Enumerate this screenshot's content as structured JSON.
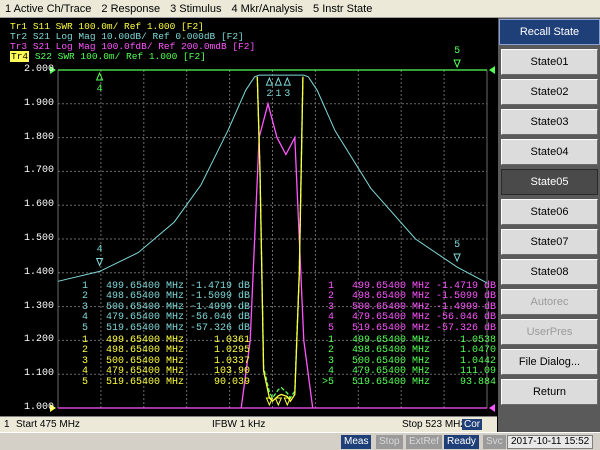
{
  "menu": [
    "1 Active Ch/Trace",
    "2 Response",
    "3 Stimulus",
    "4 Mkr/Analysis",
    "5 Instr State"
  ],
  "traces": [
    {
      "label": "Tr1",
      "text": "S11  SWR 100.0m/ Ref 1.000 [F2]",
      "color": "#ffff40"
    },
    {
      "label": "Tr2",
      "text": "S21  Log Mag 10.00dB/ Ref 0.000dB [F2]",
      "color": "#7fd8d8"
    },
    {
      "label": "Tr3",
      "text": "S21  Log Mag 100.0fdB/ Ref 200.0mdB [F2]",
      "color": "#ff55ff"
    },
    {
      "label": "Tr4",
      "text": "S22  SWR 100.0m/ Ref 1.000 [F2]",
      "color": "#55ff55"
    }
  ],
  "y_ticks": [
    "2.000",
    "1.900",
    "1.800",
    "1.700",
    "1.600",
    "1.500",
    "1.400",
    "1.300",
    "1.200",
    "1.100",
    "1.000"
  ],
  "chart_data": {
    "type": "line",
    "x_start_mhz": 475,
    "x_stop_mhz": 523,
    "ylim": [
      1.0,
      2.0
    ],
    "grid": true,
    "series": [
      {
        "name": "Tr2",
        "x": [
          475,
          479.654,
          484,
          488,
          491,
          494,
          496,
          497,
          497.5,
          502.5,
          503,
          504,
          506,
          510,
          515,
          519.654,
          523
        ],
        "y": [
          1.375,
          1.404,
          1.46,
          1.55,
          1.66,
          1.82,
          1.94,
          1.98,
          1.985,
          1.985,
          1.98,
          1.94,
          1.82,
          1.65,
          1.5,
          1.417,
          1.37
        ]
      },
      {
        "name": "Tr3",
        "x": [
          495.5,
          496.5,
          497.5,
          498.5,
          499.5,
          500.5,
          501.5,
          502.5,
          503.5
        ],
        "y": [
          1.0,
          1.2,
          1.8,
          1.9,
          1.8,
          1.75,
          1.8,
          1.2,
          1.0
        ]
      },
      {
        "name": "Tr4",
        "x": [
          497.3,
          497.6,
          498,
          498.654,
          499,
          499.654,
          500,
          500.654,
          501,
          501.5,
          502,
          502.4
        ],
        "y": [
          1.98,
          1.7,
          1.12,
          1.047,
          1.03,
          1.054,
          1.06,
          1.044,
          1.03,
          1.05,
          1.4,
          1.98
        ]
      },
      {
        "name": "Tr1",
        "x": [
          497.3,
          497.6,
          498,
          498.654,
          499,
          499.654,
          500,
          500.654,
          501,
          501.5,
          502,
          502.4
        ],
        "y": [
          1.98,
          1.7,
          1.11,
          1.03,
          1.02,
          1.036,
          1.04,
          1.034,
          1.02,
          1.04,
          1.4,
          1.98
        ]
      }
    ]
  },
  "markers_left_top": [
    {
      "n": "1",
      "freq": "499.65400 MHz",
      "val": "-1.4719 dB"
    },
    {
      "n": "2",
      "freq": "498.65400 MHz",
      "val": "-1.5099 dB"
    },
    {
      "n": "3",
      "freq": "500.65400 MHz",
      "val": "-1.4999 dB"
    },
    {
      "n": "4",
      "freq": "479.65400 MHz",
      "val": "-56.046 dB"
    },
    {
      "n": "5",
      "freq": "519.65400 MHz",
      "val": "-57.326 dB"
    }
  ],
  "markers_left_bottom": [
    {
      "n": "1",
      "freq": "499.65400 MHz",
      "val": "1.0361"
    },
    {
      "n": "2",
      "freq": "498.65400 MHz",
      "val": "1.0295"
    },
    {
      "n": "3",
      "freq": "500.65400 MHz",
      "val": "1.0337"
    },
    {
      "n": "4",
      "freq": "479.65400 MHz",
      "val": "103.90"
    },
    {
      "n": "5",
      "freq": "519.65400 MHz",
      "val": "90.039"
    }
  ],
  "markers_right_top": [
    {
      "n": "1",
      "freq": "499.65400 MHz",
      "val": "-1.4719 dB"
    },
    {
      "n": "2",
      "freq": "498.65400 MHz",
      "val": "-1.5099 dB"
    },
    {
      "n": "3",
      "freq": "500.65400 MHz",
      "val": "-1.4999 dB"
    },
    {
      "n": "4",
      "freq": "479.65400 MHz",
      "val": "-56.046 dB"
    },
    {
      "n": "5",
      "freq": "519.65400 MHz",
      "val": "-57.326 dB"
    }
  ],
  "markers_right_bottom": [
    {
      "n": "1",
      "freq": "499.65400 MHz",
      "val": "1.0538"
    },
    {
      "n": "2",
      "freq": "498.65400 MHz",
      "val": "1.0470"
    },
    {
      "n": "3",
      "freq": "500.65400 MHz",
      "val": "1.0442"
    },
    {
      "n": "4",
      "freq": "479.65400 MHz",
      "val": "111.09"
    },
    {
      "n": ">5",
      "freq": "519.65400 MHz",
      "val": "93.884"
    }
  ],
  "status": {
    "channel": "1",
    "start": "Start 475 MHz",
    "ifbw": "IFBW 1 kHz",
    "stop": "Stop 523 MHz",
    "cor": "Cor"
  },
  "softkeys": {
    "title": "Recall State",
    "items": [
      {
        "label": "State01",
        "state": "normal"
      },
      {
        "label": "State02",
        "state": "normal"
      },
      {
        "label": "State03",
        "state": "normal"
      },
      {
        "label": "State04",
        "state": "normal"
      },
      {
        "label": "State05",
        "state": "active"
      },
      {
        "label": "State06",
        "state": "normal"
      },
      {
        "label": "State07",
        "state": "normal"
      },
      {
        "label": "State08",
        "state": "normal"
      },
      {
        "label": "Autorec",
        "state": "disabled"
      },
      {
        "label": "UserPres",
        "state": "disabled"
      },
      {
        "label": "File Dialog...",
        "state": "normal"
      },
      {
        "label": "Return",
        "state": "normal"
      }
    ]
  },
  "bottom": {
    "meas": "Meas",
    "stop": "Stop",
    "extref": "ExtRef",
    "ready": "Ready",
    "svc": "Svc",
    "datetime": "2017-10-11 15:52"
  },
  "marker_labels": [
    "1",
    "2",
    "3",
    "4",
    "5"
  ]
}
